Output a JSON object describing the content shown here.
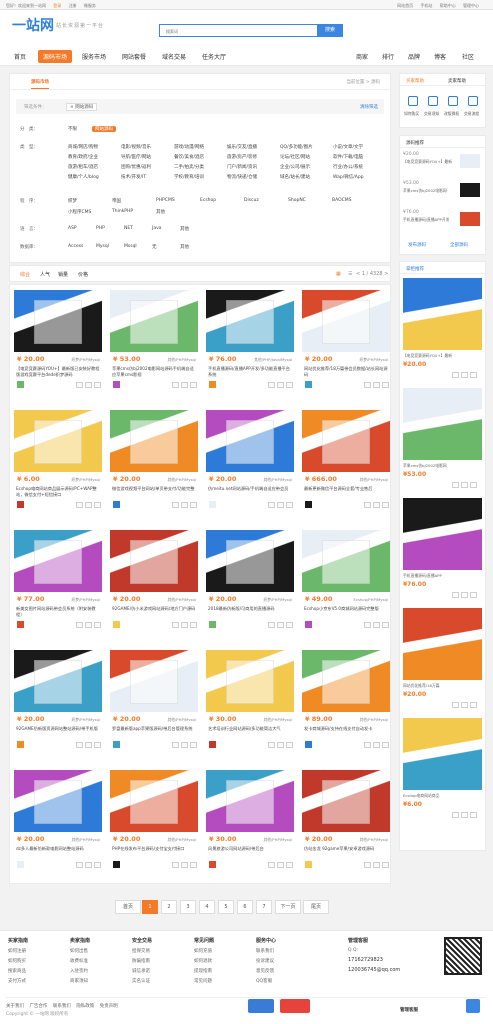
{
  "topbar": {
    "welcome": "您好！欢迎来到一站网",
    "login": "登录",
    "register": "注册",
    "plaza": "微服务",
    "links": [
      "网站首页",
      "手机站",
      "帮助中心",
      "管理中心"
    ]
  },
  "logo": "一站网",
  "slogan": "站长资源第一平台",
  "search": {
    "placeholder": "搜索词",
    "button": "搜索"
  },
  "nav": [
    "首页",
    "源码市场",
    "服务市场",
    "网站套餐",
    "域名交易",
    "任务大厅",
    "商家",
    "排行",
    "品牌",
    "博客",
    "社区"
  ],
  "main": {
    "tab": "源码市场",
    "right": "当前位置 > 源码",
    "filter": {
      "label": "筛选条件：",
      "tag": "× 网站源码",
      "clear": "清除筛选"
    },
    "rows": [
      {
        "key": "分　类：",
        "vals": [
          "不限",
          "网站源码"
        ]
      },
      {
        "key": "类　型：",
        "vals": [
          "商城/网店/购物",
          "电影/视频/音乐",
          "游戏/动漫/网络",
          "娱乐/交友/直播",
          "QQ/多功能/图片",
          "小说/文章/文学",
          "教育/政府/企业",
          "导航/医疗/网站",
          "餐饮/美食/酒店",
          "旅游/房产/装修",
          "论坛/社区/网站",
          "软件/下载/电脑",
          "旅游/租车/酒店",
          "团购/优惠/返利",
          "二手/拍卖/分类",
          "门户/新闻/资讯",
          "企业/公司/展示",
          "行业/办公/系统",
          "健康/个人/blog",
          "技术/开发/IT",
          "学校/教育/培训",
          "物流/快递/仓储",
          "域名/站长/建站",
          "Wap/微信/App"
        ]
      },
      {
        "key": "程　序：",
        "vals": [
          "织梦",
          "帝国",
          "PHPCMS",
          "Ecshop",
          "Discuz",
          "ShopNC",
          "BAOCMS",
          "小程序CMS",
          "ThinkPHP",
          "其他"
        ]
      },
      {
        "key": "语　言：",
        "vals": [
          "ASP",
          "PHP",
          "NET",
          "Java",
          "其他"
        ]
      },
      {
        "key": "数据库：",
        "vals": [
          "Access",
          "Mysql",
          "Mssql",
          "无",
          "其他"
        ]
      }
    ]
  },
  "sort": {
    "tabs": [
      "综合",
      "人气",
      "销量",
      "价格"
    ],
    "page": "< 1 / 4328 >"
  },
  "cards": [
    {
      "price": "¥ 20.00",
      "cat": "织梦/PHP/Mysql",
      "title": "【电竞竞赛源码YOU+】最新版已安装好教程版游戏竞赛平台dede织梦源码"
    },
    {
      "price": "¥ 53.00",
      "cat": "其他/PHP/Mysql",
      "title": "苹果cms仿bj2002电影网站源码手机端自适应苹果cms影视"
    },
    {
      "price": "¥ 76.00",
      "cat": "其他/PHP/Java/Mysql",
      "title": "手机直播源码/直播APP开发/多功能直播平台系统"
    },
    {
      "price": "¥ 20.00",
      "cat": "织梦/PHP/Mysql",
      "title": "网站优化推荐/18万篇带会员数据/站长网站源码"
    },
    {
      "price": "¥ 6.00",
      "cat": "织梦/PHP/Mysql",
      "title": "Ecshop电商网站商品展示源码/PC+WAP整站，微信支付+短信接口"
    },
    {
      "price": "¥ 20.00",
      "cat": "其他/PHP/Mysql",
      "title": "微信游戏视频平台网站/单页带支付/功能完整"
    },
    {
      "price": "¥ 20.00",
      "cat": "其他/PHP/Mysql",
      "title": "仿meitu.net网站源码/手机端自适应带会员"
    },
    {
      "price": "¥ 666.00",
      "cat": "其他/PHP/Mysql",
      "title": "最新更新微信平台源码全套/专业售后"
    },
    {
      "price": "¥ 77.00",
      "cat": "织梦/PHP/Mysql",
      "title": "新美女图片网站源码带会员系统（附安装教程）"
    },
    {
      "price": "¥ 20.00",
      "cat": "其他/PHP/Mysql",
      "title": "92GAME/仿小米游戏网站源码/地方门户源码"
    },
    {
      "price": "¥ 20.00",
      "cat": "织梦/PHP/Mysql",
      "title": "2018最新仿新版/可商用的直播源码"
    },
    {
      "price": "¥ 49.00",
      "cat": "Ecshop/PHP/Mysql",
      "title": "Ecshop小京东V5.0商城网站源码完整版"
    },
    {
      "price": "¥ 20.00",
      "cat": "织梦/PHP/Mysql",
      "title": "92GAME仿新版资源网站整站源码/带手机版"
    },
    {
      "price": "¥ 20.00",
      "cat": "其他/PHP/Mysql",
      "title": "罗盘最新版app苹果版源码/带后台管理系统"
    },
    {
      "price": "¥ 30.00",
      "cat": "其他/PHP/Mysql",
      "title": "艺术培训行业网站源码/多功能简洁大气"
    },
    {
      "price": "¥ 89.00",
      "cat": "其他/PHP/Mysql",
      "title": "发卡商城源码/支持在线支付自动发卡"
    },
    {
      "price": "¥ 20.00",
      "cat": "其他/PHP/Mysql",
      "title": "dz多人最新仿新款电影网站整站源码"
    },
    {
      "price": "¥ 20.00",
      "cat": "其他/PHP/Mysql",
      "title": "PHP在线发布平台源码/支付宝支付接口"
    },
    {
      "price": "¥ 30.00",
      "cat": "其他/PHP/Mysql",
      "title": "风景旅游公司网站源码/带后台"
    },
    {
      "price": "¥ 20.00",
      "cat": "其他/PHP/Mysql",
      "title": "仿站金龙 92game苹果/安卓游戏源码"
    }
  ],
  "pager": {
    "first": "首页",
    "pages": [
      "1",
      "2",
      "3",
      "4",
      "5",
      "6",
      "7"
    ],
    "next": "下一页",
    "last": "尾页"
  },
  "sidebar": {
    "tabs": [
      "买家帮助",
      "卖家帮助"
    ],
    "icons": [
      "如何购买",
      "交易须知",
      "改版换权",
      "交易流程"
    ],
    "rank_title": "源码推荐",
    "rank": [
      {
        "price": "¥20.00",
        "title": "【电竞竞赛源码YOU+】最新"
      },
      {
        "price": "¥53.00",
        "title": "苹果cms仿bj2002电影网"
      },
      {
        "price": "¥76.00",
        "title": "手机直播源码/直播APP开发"
      }
    ],
    "actions": [
      "发布源码",
      "全部源码"
    ],
    "promo_title": "掌柜推荐",
    "promo": [
      {
        "price": "¥20.00",
        "title": "【电竞竞赛源码YOU+】最新"
      },
      {
        "price": "¥53.00",
        "title": "苹果cms仿bj2002电影网"
      },
      {
        "price": "¥76.00",
        "title": "手机直播源码/直播APP"
      },
      {
        "price": "¥20.00",
        "title": "网站优化推荐/18万篇"
      },
      {
        "price": "¥6.00",
        "title": "Ecshop电商网站商品"
      }
    ]
  },
  "footer": {
    "cols": [
      {
        "h": "买家指南",
        "items": [
          "如何注册",
          "如何购买",
          "搜索商品",
          "支付方式"
        ]
      },
      {
        "h": "卖家指南",
        "items": [
          "如何出售",
          "收费标准",
          "入驻签约",
          "商家须知"
        ]
      },
      {
        "h": "安全交易",
        "items": [
          "担保交易",
          "防骗指南",
          "诚信承诺",
          "实名认证"
        ]
      },
      {
        "h": "常见问题",
        "items": [
          "如何充值",
          "如何退款",
          "提现指南",
          "常见问题"
        ]
      },
      {
        "h": "服务中心",
        "items": [
          "联系我们",
          "投诉建议",
          "意见反馈",
          "QQ客服"
        ]
      }
    ],
    "contact": {
      "title": "管理客服",
      "qq": "Q Q:",
      "tel": "17162729823",
      "email": "120036745@qq.com"
    },
    "bottom": [
      "关于我们",
      "广告合作",
      "联系我们",
      "隐私政策",
      "免责声明"
    ],
    "copyright": "Copyright © 一站网 版权所有",
    "mgr": "管理客服"
  }
}
